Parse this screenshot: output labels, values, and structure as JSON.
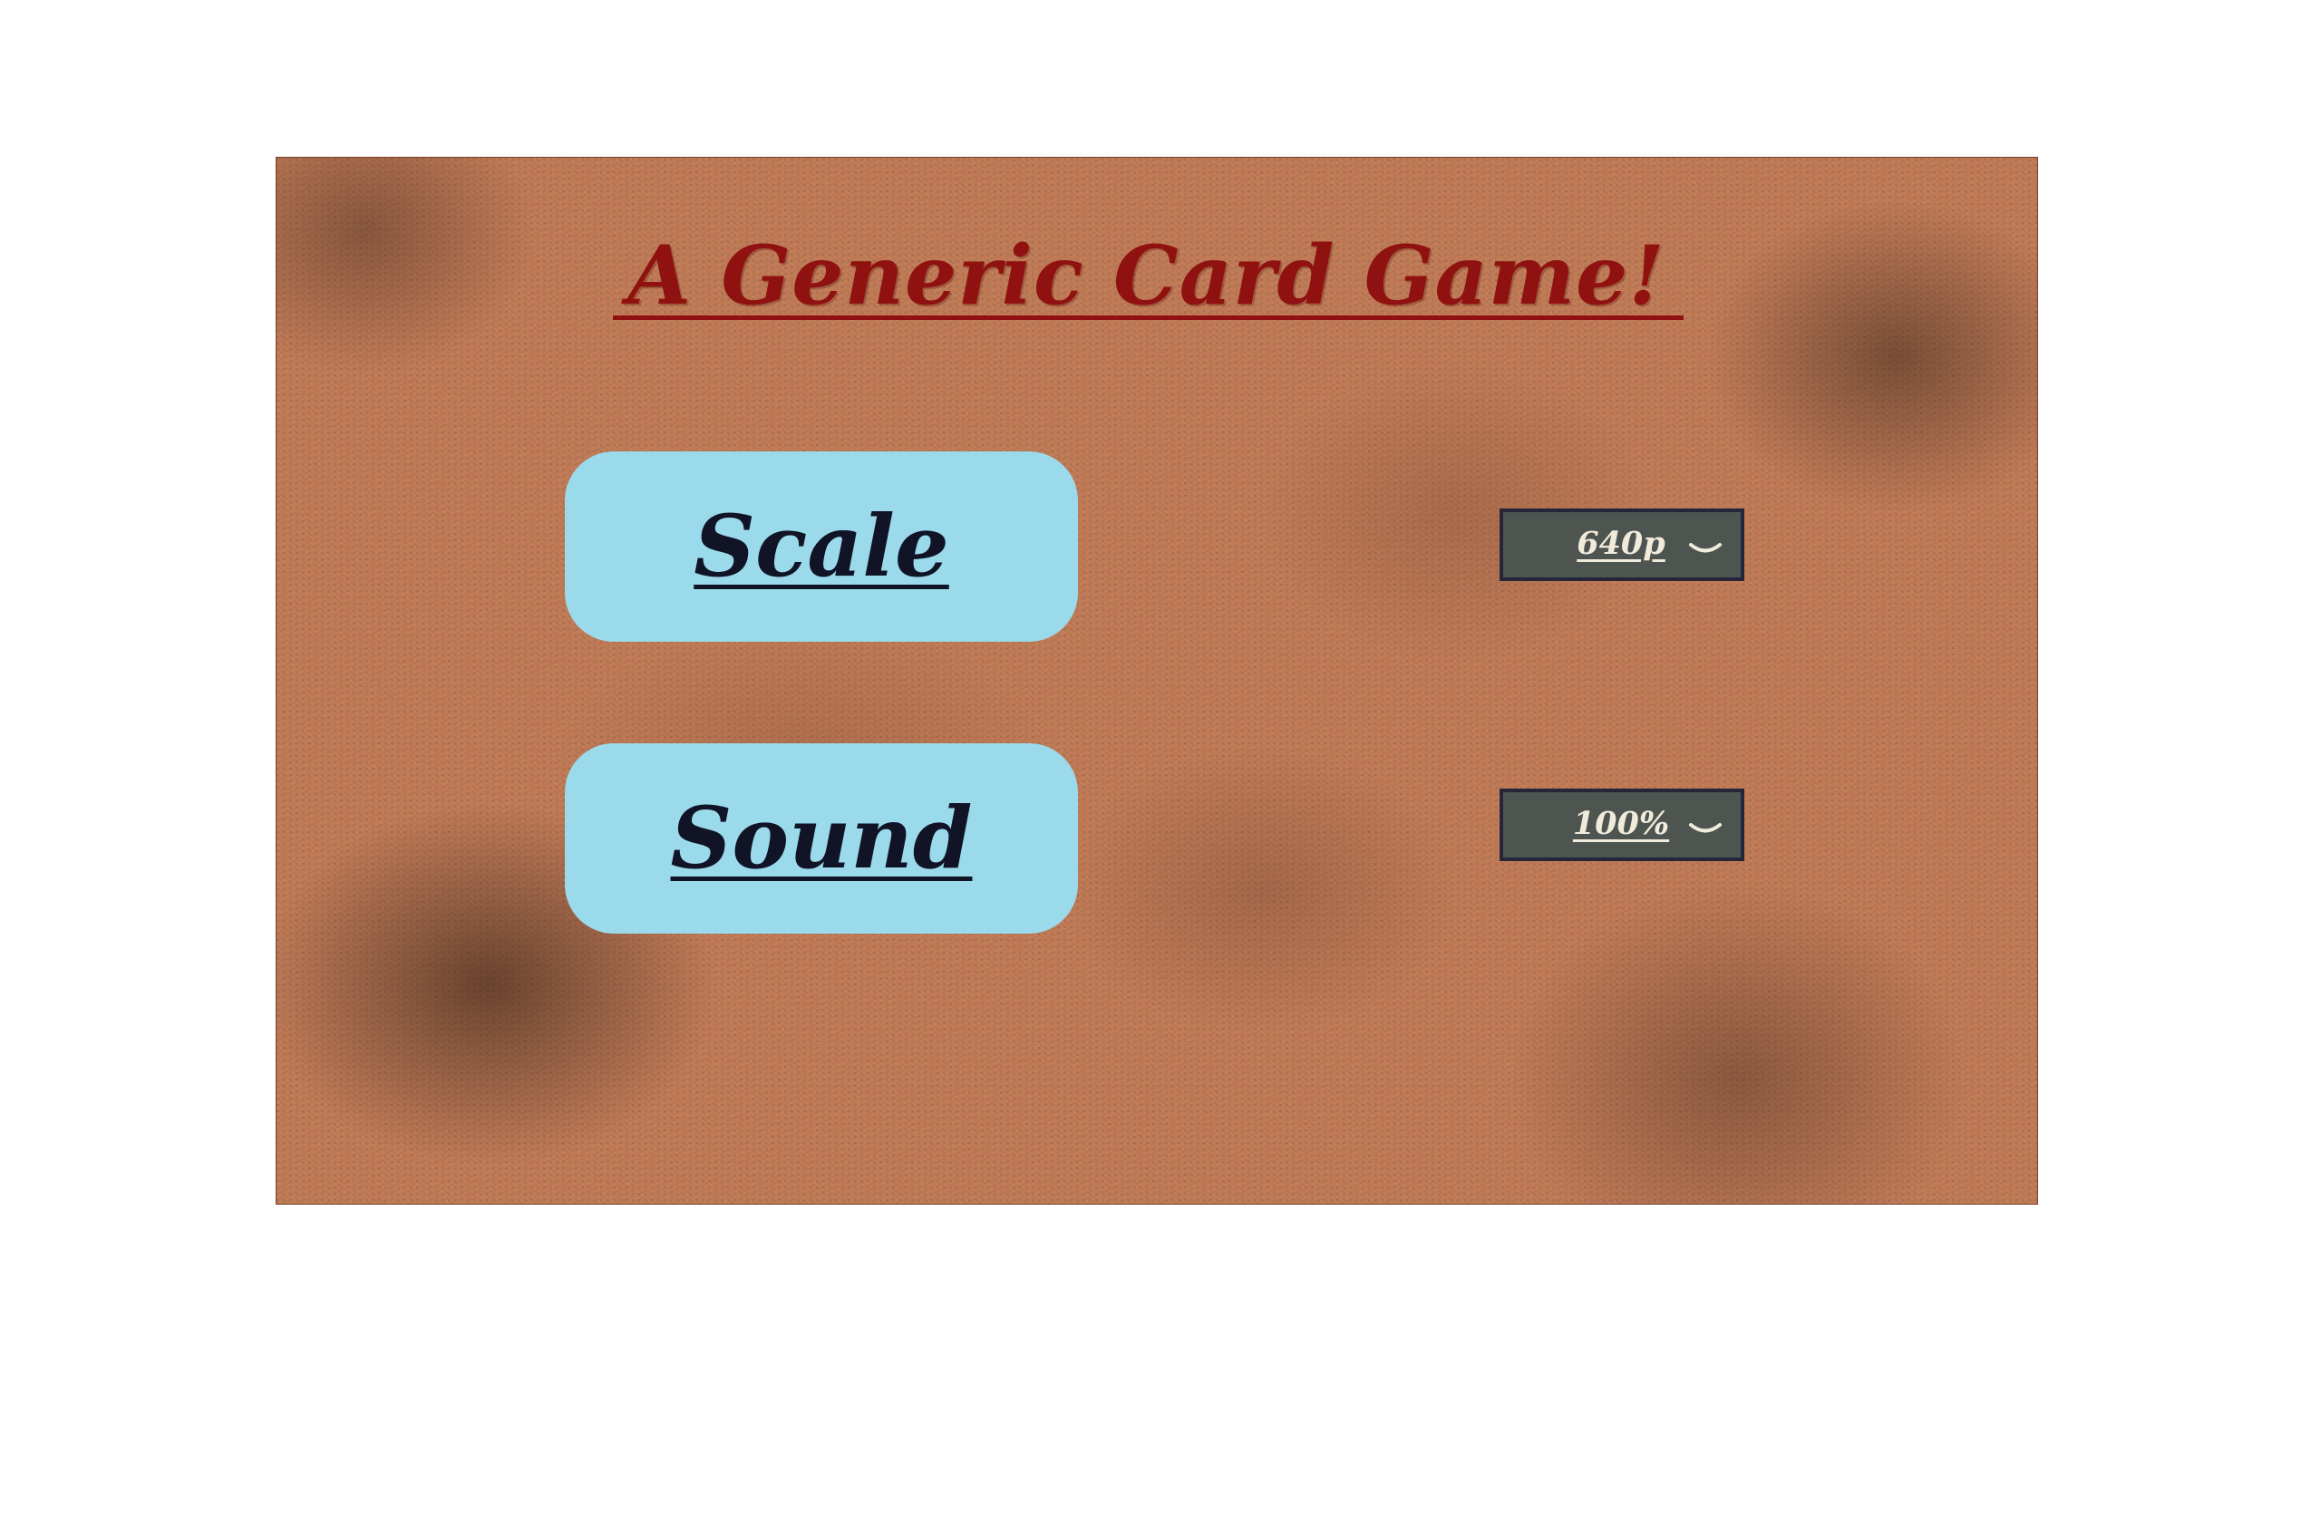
{
  "app": {
    "title": "A Generic Card Game!"
  },
  "settings": {
    "scale": {
      "label": "Scale",
      "selected_value": "640p",
      "icon": "chevron-down-icon"
    },
    "sound": {
      "label": "Sound",
      "selected_value": "100%",
      "icon": "chevron-down-icon"
    }
  },
  "colors": {
    "background": "#c07a55",
    "title": "#8f1210",
    "button": "#9bdaea",
    "button_text": "#101426",
    "dropdown": "#4e5550",
    "dropdown_border": "#25263a",
    "dropdown_text": "#f1ebdc"
  }
}
